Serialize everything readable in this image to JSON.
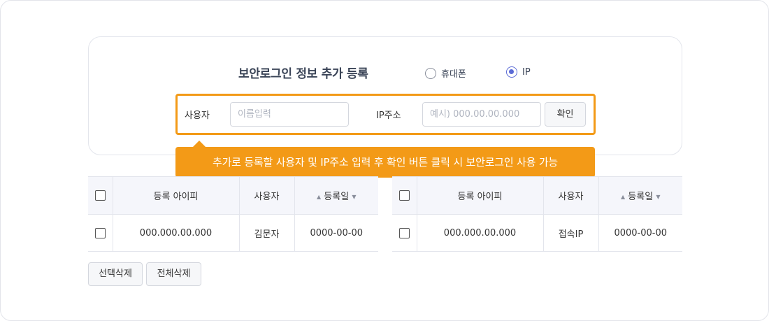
{
  "form": {
    "title": "보안로그인 정보 추가 등록",
    "radio_phone_label": "휴대폰",
    "radio_ip_label": "IP",
    "selected_type": "IP",
    "user_label": "사용자",
    "user_placeholder": "이름입력",
    "ip_label": "IP주소",
    "ip_placeholder": "예시) 000.00.00.000",
    "confirm_label": "확인"
  },
  "tooltip": {
    "text": "추가로 등록할 사용자 및 IP주소 입력 후 확인 버튼 클릭 시 보안로그인 사용 가능"
  },
  "table_left": {
    "headers": {
      "ip": "등록 아이피",
      "user": "사용자",
      "date": "등록일"
    },
    "rows": [
      {
        "ip": "000.000.00.000",
        "user": "김문자",
        "date": "0000-00-00"
      }
    ]
  },
  "table_right": {
    "headers": {
      "ip": "등록 아이피",
      "user": "사용자",
      "date": "등록일"
    },
    "rows": [
      {
        "ip": "000.000.00.000",
        "user": "접속IP",
        "date": "0000-00-00"
      }
    ]
  },
  "actions": {
    "delete_selected": "선택삭제",
    "delete_all": "전체삭제"
  },
  "colors": {
    "accent": "#f39a17",
    "radio_selected": "#5b6bd6",
    "title": "#3a4457"
  }
}
